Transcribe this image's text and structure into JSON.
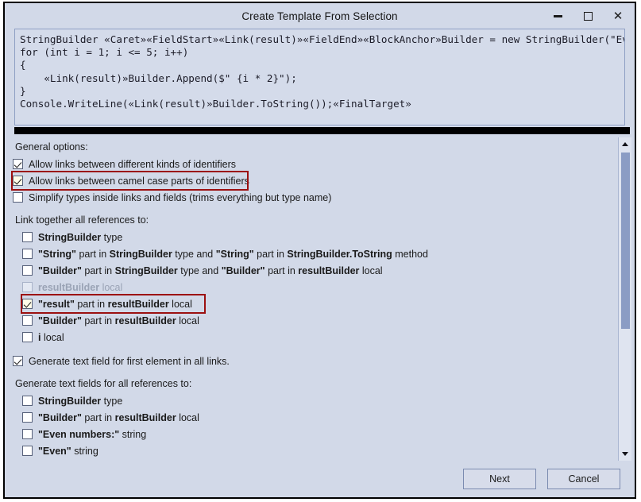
{
  "window": {
    "title": "Create Template From Selection",
    "controls": {
      "minimize": "minimize-button",
      "maximize": "maximize-button",
      "close": "close-button"
    }
  },
  "code": {
    "lines": [
      "StringBuilder «Caret»«FieldStart»«Link(result)»«FieldEnd»«BlockAnchor»Builder = new StringBuilder(\"Even numbers:\");",
      "for (int i = 1; i <= 5; i++)",
      "{",
      "    «Link(result)»Builder.Append($\" {i * 2}\");",
      "}",
      "Console.WriteLine(«Link(result)»Builder.ToString());«FinalTarget»"
    ]
  },
  "options": {
    "general_label": "General options:",
    "general_items": [
      {
        "checked": true,
        "highlighted": false,
        "parts": [
          {
            "t": "Allow links between different kinds of identifiers",
            "b": false
          }
        ]
      },
      {
        "checked": true,
        "highlighted": true,
        "parts": [
          {
            "t": "Allow links between camel case parts of identifiers",
            "b": false
          }
        ]
      },
      {
        "checked": false,
        "highlighted": false,
        "parts": [
          {
            "t": "Simplify types inside links and fields (trims everything but type name)",
            "b": false
          }
        ]
      }
    ],
    "link_label": "Link together all references to:",
    "link_items": [
      {
        "checked": false,
        "disabled": false,
        "highlighted": false,
        "parts": [
          {
            "t": "StringBuilder",
            "b": true
          },
          {
            "t": " type",
            "b": false
          }
        ]
      },
      {
        "checked": false,
        "disabled": false,
        "highlighted": false,
        "parts": [
          {
            "t": "\"String\"",
            "b": true
          },
          {
            "t": " part in ",
            "b": false
          },
          {
            "t": "StringBuilder",
            "b": true
          },
          {
            "t": " type and ",
            "b": false
          },
          {
            "t": "\"String\"",
            "b": true
          },
          {
            "t": " part in ",
            "b": false
          },
          {
            "t": "StringBuilder.ToString",
            "b": true
          },
          {
            "t": " method",
            "b": false
          }
        ]
      },
      {
        "checked": false,
        "disabled": false,
        "highlighted": false,
        "parts": [
          {
            "t": "\"Builder\"",
            "b": true
          },
          {
            "t": " part in ",
            "b": false
          },
          {
            "t": "StringBuilder",
            "b": true
          },
          {
            "t": " type and ",
            "b": false
          },
          {
            "t": "\"Builder\"",
            "b": true
          },
          {
            "t": " part in ",
            "b": false
          },
          {
            "t": "resultBuilder",
            "b": true
          },
          {
            "t": " local",
            "b": false
          }
        ]
      },
      {
        "checked": false,
        "disabled": true,
        "highlighted": false,
        "parts": [
          {
            "t": "resultBuilder",
            "b": true
          },
          {
            "t": " local",
            "b": false
          }
        ]
      },
      {
        "checked": true,
        "disabled": false,
        "highlighted": true,
        "parts": [
          {
            "t": "\"result\"",
            "b": true
          },
          {
            "t": " part in ",
            "b": false
          },
          {
            "t": "resultBuilder",
            "b": true
          },
          {
            "t": " local",
            "b": false
          }
        ]
      },
      {
        "checked": false,
        "disabled": false,
        "highlighted": false,
        "parts": [
          {
            "t": "\"Builder\"",
            "b": true
          },
          {
            "t": " part in ",
            "b": false
          },
          {
            "t": "resultBuilder",
            "b": true
          },
          {
            "t": " local",
            "b": false
          }
        ]
      },
      {
        "checked": false,
        "disabled": false,
        "highlighted": false,
        "parts": [
          {
            "t": "i",
            "b": true
          },
          {
            "t": " local",
            "b": false
          }
        ]
      }
    ],
    "generate_first": {
      "checked": true,
      "parts": [
        {
          "t": "Generate text field for first element in all links.",
          "b": false
        }
      ]
    },
    "generate_label": "Generate text fields for all references to:",
    "generate_items": [
      {
        "checked": false,
        "parts": [
          {
            "t": "StringBuilder",
            "b": true
          },
          {
            "t": " type",
            "b": false
          }
        ]
      },
      {
        "checked": false,
        "parts": [
          {
            "t": "\"Builder\"",
            "b": true
          },
          {
            "t": " part in ",
            "b": false
          },
          {
            "t": "resultBuilder",
            "b": true
          },
          {
            "t": " local",
            "b": false
          }
        ]
      },
      {
        "checked": false,
        "parts": [
          {
            "t": "\"Even numbers:\"",
            "b": true
          },
          {
            "t": " string",
            "b": false
          }
        ]
      },
      {
        "checked": false,
        "parts": [
          {
            "t": "\"Even\"",
            "b": true
          },
          {
            "t": " string",
            "b": false
          }
        ]
      }
    ]
  },
  "scrollbar": {
    "up_arrow": "scroll-up-arrow",
    "down_arrow": "scroll-down-arrow",
    "thumb": "scroll-thumb"
  },
  "footer": {
    "next_label": "Next",
    "cancel_label": "Cancel"
  },
  "colors": {
    "dialog_bg": "#d2d9e8",
    "highlight_red": "#9c1010",
    "scroll_thumb": "#8b9cc4",
    "checked_cream": "#fffce8"
  }
}
